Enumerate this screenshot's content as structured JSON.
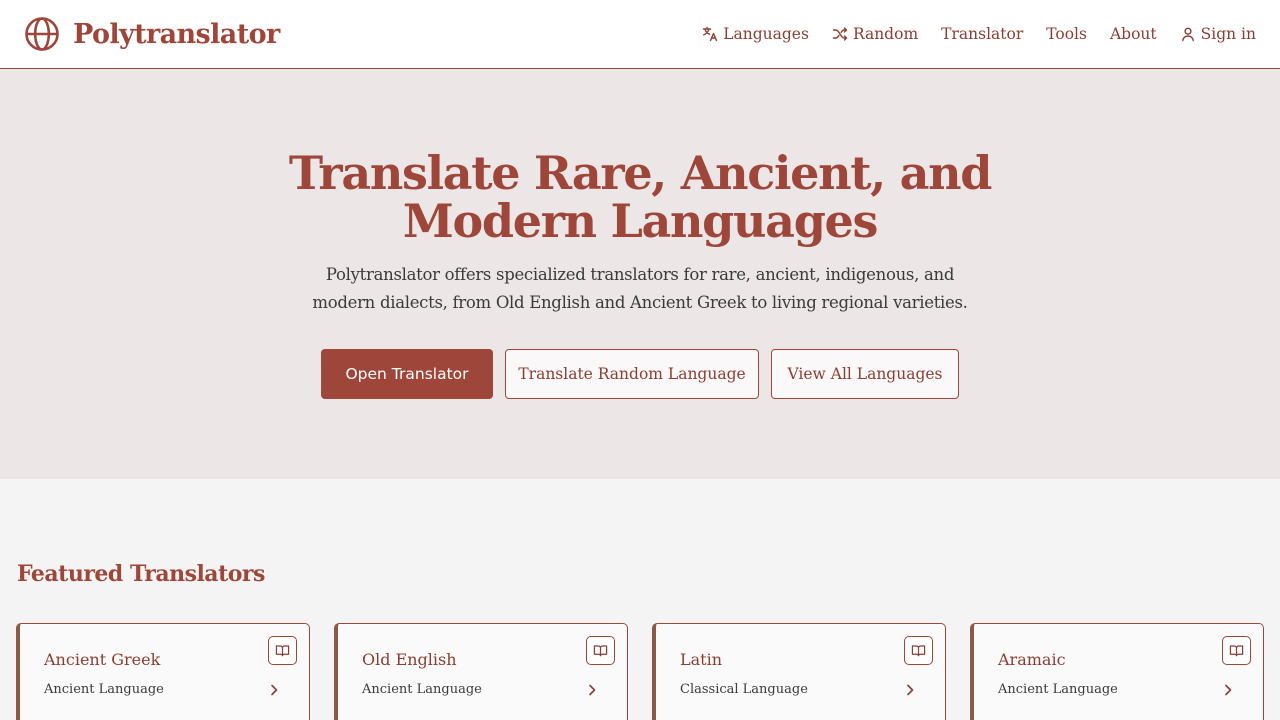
{
  "header": {
    "brand_name": "Polytranslator",
    "logo_icon": "globe-icon",
    "nav": [
      {
        "label": "Languages",
        "icon": "translate-icon"
      },
      {
        "label": "Random",
        "icon": "shuffle-icon"
      },
      {
        "label": "Translator"
      },
      {
        "label": "Tools"
      },
      {
        "label": "About"
      },
      {
        "label": "Sign in",
        "icon": "user-icon"
      }
    ]
  },
  "hero": {
    "title": "Translate Rare, Ancient, and Modern Languages",
    "subtitle": "Polytranslator offers specialized translators for rare, ancient, indigenous, and modern dialects, from Old English and Ancient Greek to living regional varieties.",
    "buttons": {
      "primary": "Open Translator",
      "random": "Translate Random Language",
      "all": "View All Languages"
    }
  },
  "featured": {
    "title": "Featured Translators",
    "cards": [
      {
        "name": "Ancient Greek",
        "type": "Ancient Language",
        "icon": "book-icon"
      },
      {
        "name": "Old English",
        "type": "Ancient Language",
        "icon": "book-icon"
      },
      {
        "name": "Latin",
        "type": "Classical Language",
        "icon": "book-icon"
      },
      {
        "name": "Aramaic",
        "type": "Ancient Language",
        "icon": "book-icon"
      }
    ]
  },
  "colors": {
    "brand": "#9e4639",
    "hero_bg": "#ece6e6",
    "page_bg": "#f4f4f4",
    "card_accent": "#8a5a45"
  }
}
